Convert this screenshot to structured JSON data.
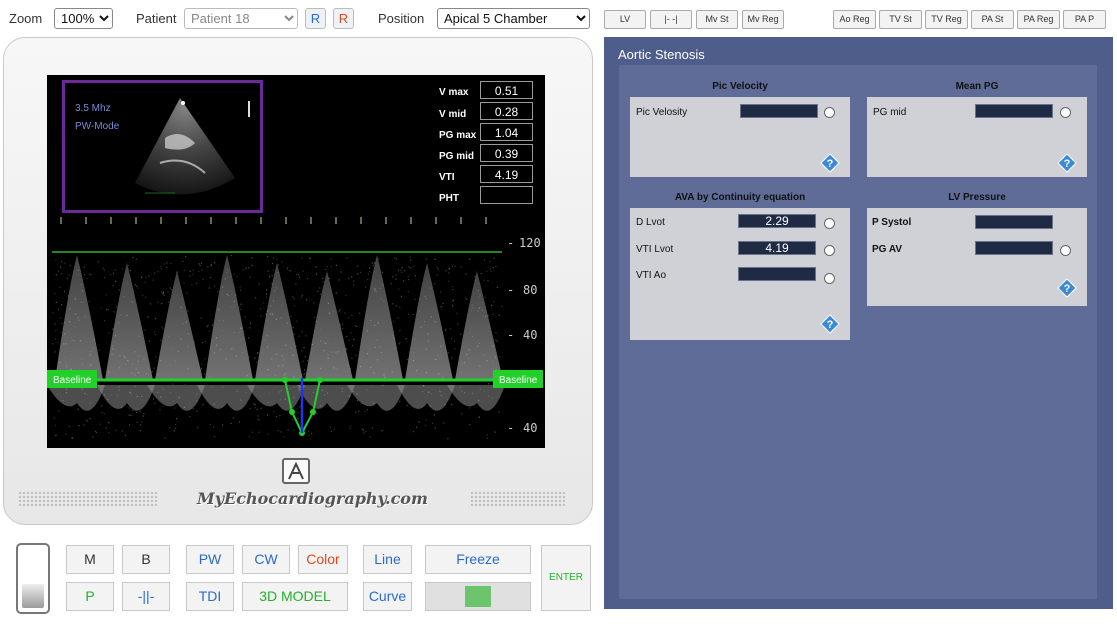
{
  "toolbar": {
    "zoom_label": "Zoom",
    "zoom_value": "100%",
    "patient_label": "Patient",
    "patient_value": "Patient 18",
    "reset_blue": "R",
    "reset_red": "R",
    "position_label": "Position",
    "position_value": "Apical 5 Chamber",
    "view_buttons": [
      "LV",
      "|- -|",
      "Mv St",
      "Mv Reg"
    ],
    "valve_buttons": [
      "Ao Reg",
      "TV St",
      "TV Reg",
      "PA St",
      "PA Reg",
      "PA P"
    ]
  },
  "screen": {
    "freq": "3.5 Mhz",
    "mode": "PW-Mode",
    "baseline_left": "Baseline",
    "baseline_right": "Baseline",
    "scale_ticks": [
      "120",
      "80",
      "40",
      "40"
    ],
    "measurements": [
      {
        "label": "V max",
        "value": "0.51"
      },
      {
        "label": "V mid",
        "value": "0.28"
      },
      {
        "label": "PG max",
        "value": "1.04"
      },
      {
        "label": "PG mid",
        "value": "0.39"
      },
      {
        "label": "VTI",
        "value": "4.19"
      },
      {
        "label": "PHT",
        "value": ""
      }
    ]
  },
  "device": {
    "brand": "MyEchocardiography.com"
  },
  "controls": {
    "m": "M",
    "b": "B",
    "pw": "PW",
    "cw": "CW",
    "color": "Color",
    "line": "Line",
    "freeze": "Freeze",
    "enter": "ENTER",
    "p": "P",
    "sep": "-||-",
    "tdi": "TDI",
    "model": "3D MODEL",
    "curve": "Curve"
  },
  "panel": {
    "title": "Aortic Stenosis",
    "pic_velocity": {
      "title": "Pic Velocity",
      "field_label": "Pic Velosity",
      "value": ""
    },
    "mean_pg": {
      "title": "Mean PG",
      "field_label": "PG mid",
      "value": ""
    },
    "ava": {
      "title": "AVA by Continuity equation",
      "fields": [
        {
          "label": "D Lvot",
          "value": "2.29"
        },
        {
          "label": "VTI Lvot",
          "value": "4.19"
        },
        {
          "label": "VTI Ao",
          "value": ""
        }
      ]
    },
    "lv_pressure": {
      "title": "LV Pressure",
      "fields": [
        {
          "label": "P Systol",
          "value": ""
        },
        {
          "label": "PG AV",
          "value": ""
        }
      ]
    }
  },
  "colors": {
    "panel_bg": "#4f5d8b",
    "baseline_green": "#22d02a",
    "roi_purple": "#6a2a9a"
  }
}
